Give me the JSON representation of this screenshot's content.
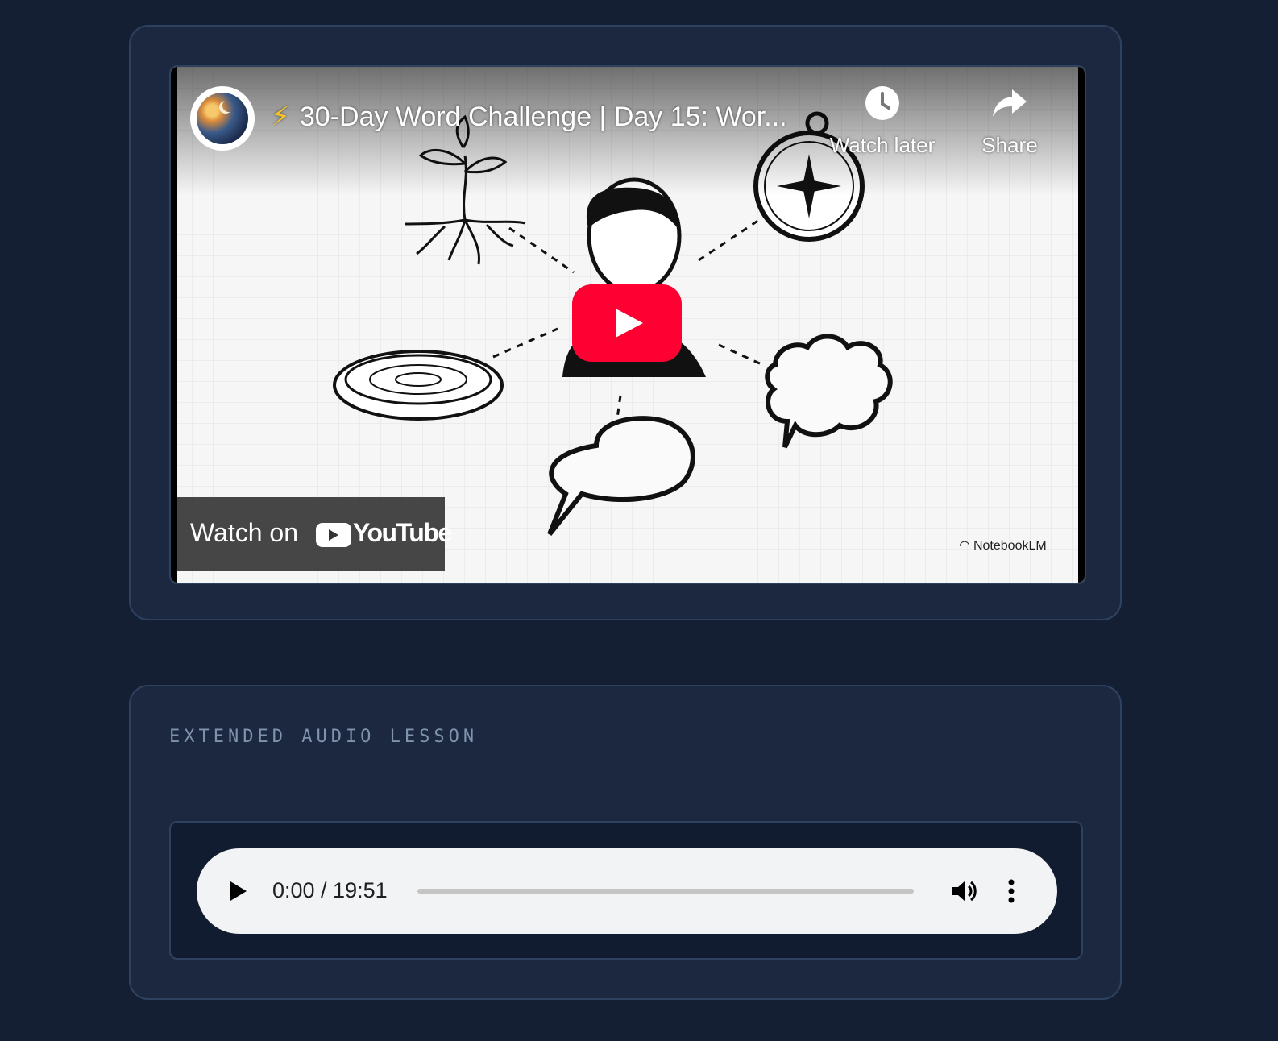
{
  "video": {
    "title_prefix": "⚡",
    "title": "30-Day Word Challenge | Day 15: Wor...",
    "watch_later": "Watch later",
    "share": "Share",
    "watch_on": "Watch on",
    "youtube_wordmark": "YouTube",
    "watermark": "NotebookLM",
    "icons": [
      "channel-avatar",
      "clock-icon",
      "share-arrow-icon",
      "play-icon",
      "youtube-logo-icon",
      "notebooklm-icon"
    ],
    "colors": {
      "play_button": "#ff0033",
      "bolt": "#f7c325"
    }
  },
  "audio_section": {
    "label": "EXTENDED AUDIO LESSON",
    "player": {
      "time": "0:00 / 19:51",
      "progress": 0,
      "icons": [
        "play-icon",
        "volume-icon",
        "more-vert-icon"
      ]
    }
  },
  "colors": {
    "page_bg": "#141f33",
    "card_bg": "#1b2840",
    "card_border": "#2e4260",
    "label": "#7f93ad"
  }
}
